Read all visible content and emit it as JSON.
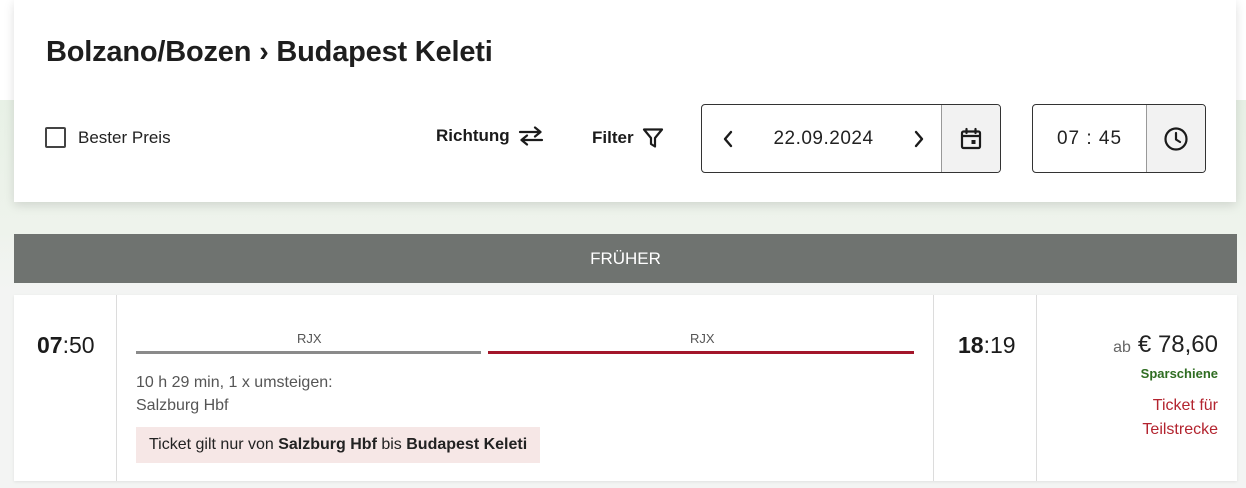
{
  "header": {
    "from": "Bolzano/Bozen",
    "separator": "›",
    "to": "Budapest Keleti"
  },
  "options": {
    "best_price_label": "Bester Preis",
    "best_price_checked": false,
    "direction_label": "Richtung",
    "filter_label": "Filter"
  },
  "date_picker": {
    "value": "22.09.2024"
  },
  "time_picker": {
    "value": "07 : 45"
  },
  "earlier_label": "FRÜHER",
  "connection": {
    "dep_hh": "07",
    "dep_mm": ":50",
    "arr_hh": "18",
    "arr_mm": ":19",
    "segments": [
      {
        "train": "RJX",
        "color": "#8a8a8a"
      },
      {
        "train": "RJX",
        "color": "#a3162a"
      }
    ],
    "duration_line": "10 h 29 min, 1 x umsteigen:",
    "transfer_station": "Salzburg Hbf",
    "notice": {
      "prefix": "Ticket gilt nur von ",
      "from": "Salzburg Hbf",
      "middle": " bis ",
      "to": "Budapest Keleti"
    },
    "price_prefix": "ab",
    "price": "€ 78,60",
    "fare_name": "Sparschiene",
    "partial_link_line1": "Ticket für",
    "partial_link_line2": "Teilstrecke"
  },
  "colors": {
    "accent_red": "#a3162a",
    "fare_green": "#2f6d22",
    "bar_grey": "#6f7370"
  }
}
